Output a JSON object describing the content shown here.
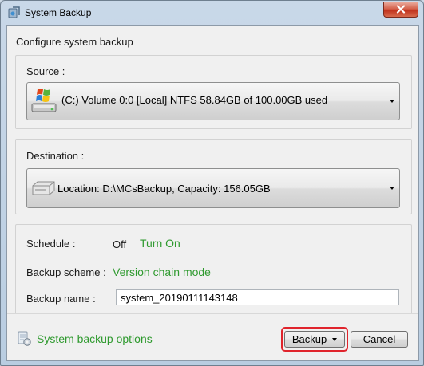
{
  "window": {
    "title": "System Backup",
    "close_icon": "close-x-icon"
  },
  "main": {
    "heading": "Configure system backup"
  },
  "source": {
    "label": "Source :",
    "value": "(C:) Volume 0:0 [Local] NTFS   58.84GB of 100.00GB used",
    "icon": "windows-drive-icon"
  },
  "destination": {
    "label": "Destination :",
    "value": "Location: D:\\MCsBackup, Capacity: 156.05GB",
    "icon": "hard-disk-icon"
  },
  "settings": {
    "schedule_label": "Schedule :",
    "schedule_value": "Off",
    "schedule_link": "Turn On",
    "scheme_label": "Backup scheme :",
    "scheme_link": "Version chain mode",
    "name_label": "Backup name :",
    "name_value": "system_20190111143148"
  },
  "footer": {
    "options_link": "System backup options",
    "backup_button": "Backup",
    "cancel_button": "Cancel"
  },
  "colors": {
    "link_green": "#2f9a2f",
    "focus_red": "#e0242c"
  }
}
